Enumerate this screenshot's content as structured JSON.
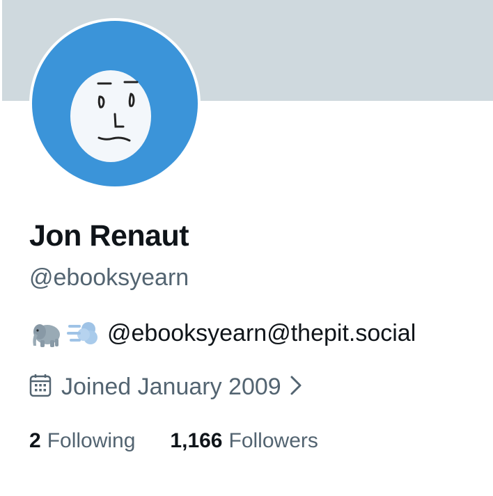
{
  "profile": {
    "display_name": "Jon Renaut",
    "handle": "@ebooksyearn",
    "bio_text": "@ebooksyearn@thepit.social",
    "bio_icons": [
      "elephant-emoji",
      "dashing-away-emoji"
    ],
    "joined_text": "Joined January 2009",
    "joined_icon": "calendar-icon",
    "stats": {
      "following": {
        "count": "2",
        "label": "Following"
      },
      "followers": {
        "count": "1,166",
        "label": "Followers"
      }
    },
    "colors": {
      "banner": "#cfd9de",
      "avatar_bg": "#3b94d9",
      "primary_text": "#0f1419",
      "secondary_text": "#536471"
    }
  }
}
